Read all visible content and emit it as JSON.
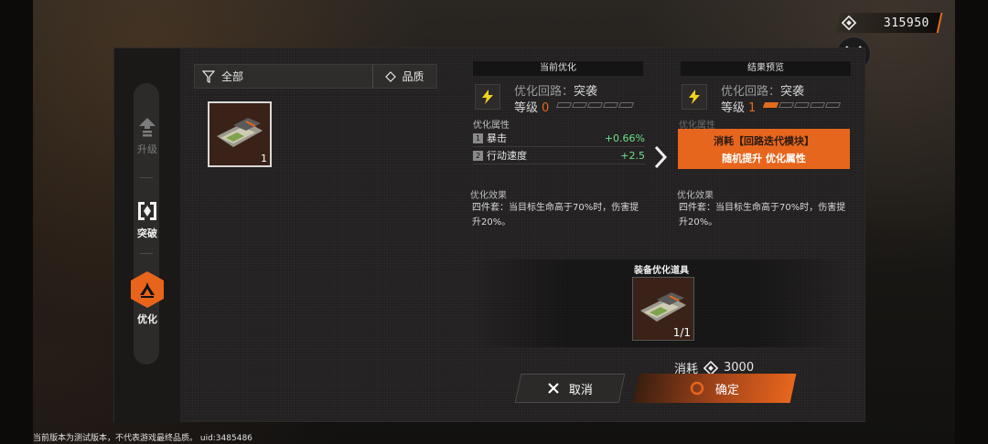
{
  "currency": {
    "value": "315950",
    "icon": "currency-diamond-icon"
  },
  "nav": [
    {
      "label": "升级",
      "icon": "upgrade-arrow-icon",
      "state": "disabled"
    },
    {
      "label": "突破",
      "icon": "breakthrough-icon",
      "state": "normal"
    },
    {
      "label": "优化",
      "icon": "optimize-icon",
      "state": "active"
    }
  ],
  "filter": {
    "all_label": "全部",
    "quality_label": "品质"
  },
  "inventory": {
    "items": [
      {
        "count": "1"
      }
    ]
  },
  "current": {
    "header": "当前优化",
    "circuit_label": "优化回路：",
    "circuit_value": "突袭",
    "level_label": "等级",
    "level_value": "0",
    "level_max": 5,
    "attr_title": "优化属性",
    "attrs": [
      {
        "idx": "1",
        "name": "暴击",
        "value": "+0.66%"
      },
      {
        "idx": "2",
        "name": "行动速度",
        "value": "+2.5"
      }
    ],
    "effect_title": "优化效果",
    "effect_text": "四件套：当目标生命高于70%时，伤害提升20%。"
  },
  "preview": {
    "header": "结果预览",
    "circuit_label": "优化回路：",
    "circuit_value": "突袭",
    "level_label": "等级",
    "level_value": "1",
    "attr_title": "优化属性",
    "consume_line1": "消耗【回路迭代模块】",
    "consume_line2": "随机提升 优化属性",
    "effect_title": "优化效果",
    "effect_text": "四件套：当目标生命高于70%时，伤害提升20%。"
  },
  "tool": {
    "title": "装备优化道具",
    "count": "1/1"
  },
  "cost": {
    "label": "消耗",
    "value": "3000"
  },
  "buttons": {
    "cancel": "取消",
    "confirm": "确定"
  },
  "footer": {
    "note": "当前版本为测试版本，不代表游戏最终品质。 uid:3485486"
  },
  "colors": {
    "accent": "#e7661d",
    "positive": "#6fe08a"
  }
}
